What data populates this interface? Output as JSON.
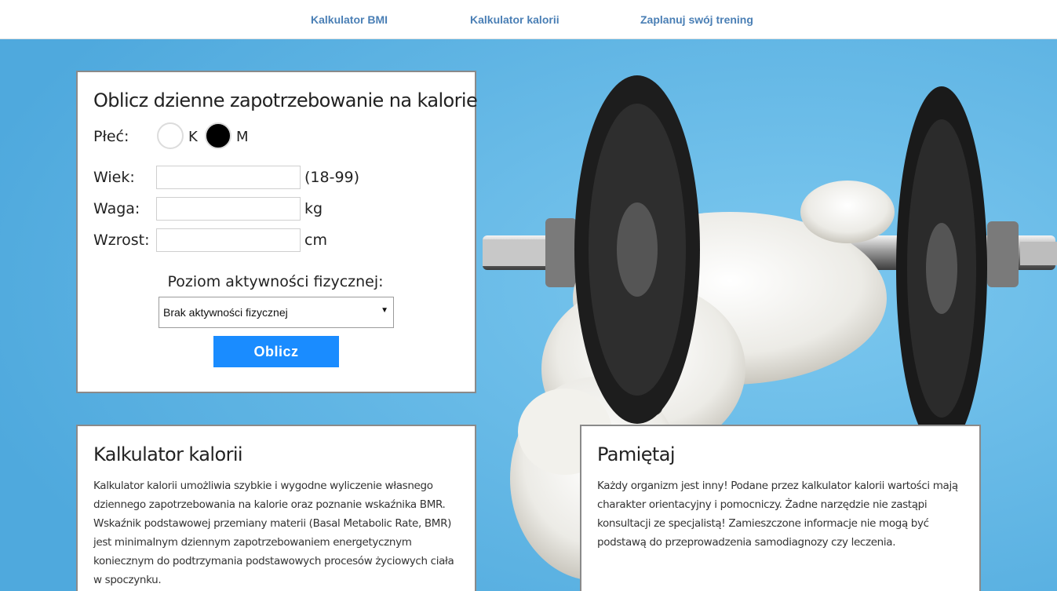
{
  "nav": {
    "items": [
      {
        "label": "Kalkulator BMI"
      },
      {
        "label": "Kalkulator kalorii"
      },
      {
        "label": "Zaplanuj swój trening"
      }
    ]
  },
  "form": {
    "title": "Oblicz dzienne zapotrzebowanie na kalorie",
    "gender_label": "Płeć:",
    "gender_options": [
      {
        "label": "K",
        "selected": false
      },
      {
        "label": "M",
        "selected": true
      }
    ],
    "fields": [
      {
        "label": "Wiek:",
        "value": "",
        "unit": "(18-99)"
      },
      {
        "label": "Waga:",
        "value": "",
        "unit": "kg"
      },
      {
        "label": "Wzrost:",
        "value": "",
        "unit": "cm"
      }
    ],
    "activity_label": "Poziom aktywności fizycznej:",
    "activity_selected": "Brak aktywności fizycznej",
    "submit_label": "Oblicz"
  },
  "info_calculator": {
    "title": "Kalkulator kalorii",
    "text": "Kalkulator kalorii umożliwia szybkie i wygodne wyliczenie własnego dziennego zapotrzebowania na kalorie oraz poznanie wskaźnika BMR. Wskaźnik podstawowej przemiany materii (Basal Metabolic Rate, BMR) jest minimalnym dziennym zapotrzebowaniem energetycznym koniecznym do podtrzymania podstawowych procesów życiowych ciała w spoczynku."
  },
  "info_remember": {
    "title": "Pamiętaj",
    "text": "Każdy organizm jest inny! Podane przez kalkulator kalorii wartości mają charakter orientacyjny i pomocniczy. Żadne narzędzie nie zastąpi konsultacji ze specjalistą! Zamieszczone informacje nie mogą być podstawą do przeprowadzenia samodiagnozy czy leczenia."
  },
  "colors": {
    "nav_link": "#4a7fb5",
    "hero_background": "#63b7e5",
    "button": "#1a8cff"
  },
  "hero_image": "white-kitten-with-dumbbell"
}
